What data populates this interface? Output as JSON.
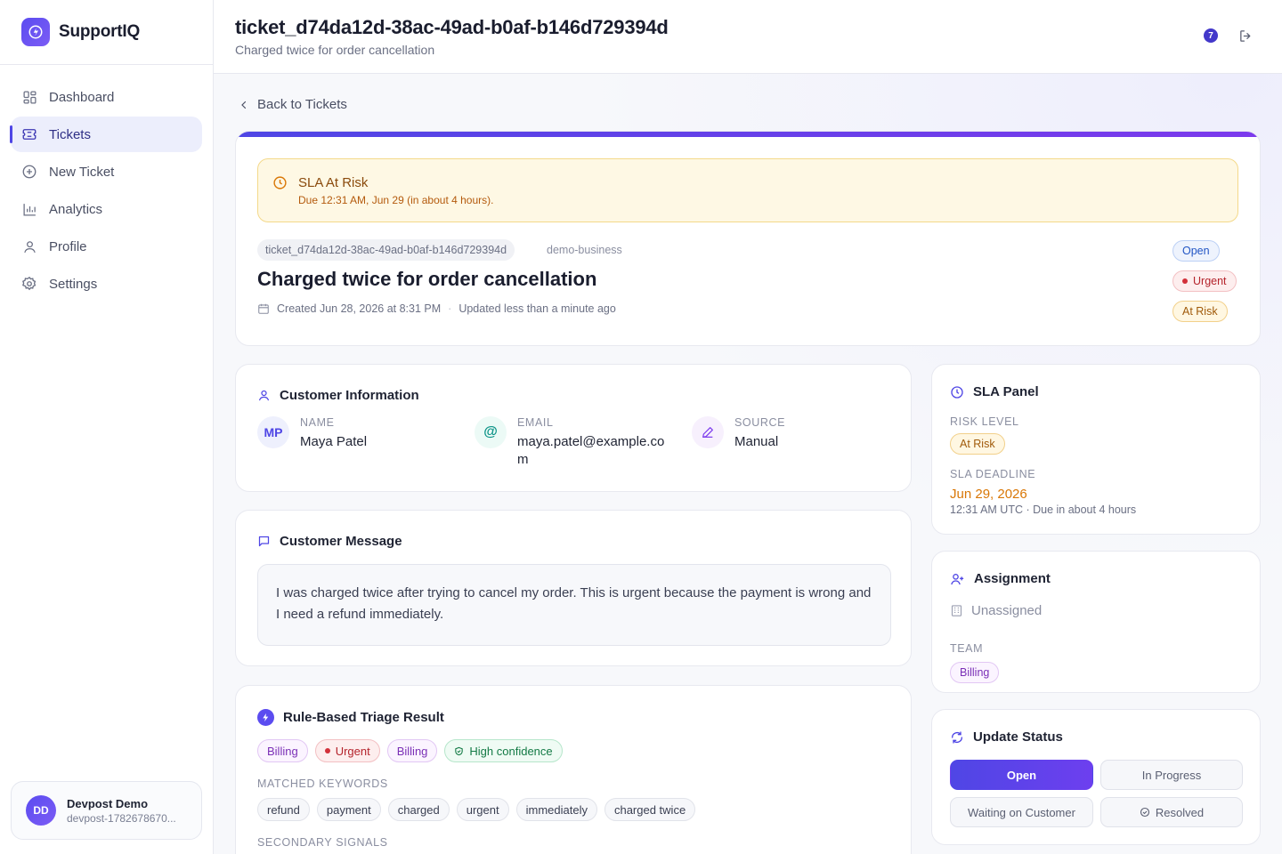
{
  "app": {
    "name": "SupportIQ"
  },
  "nav": [
    {
      "label": "Dashboard",
      "icon": "dashboard-icon"
    },
    {
      "label": "Tickets",
      "icon": "ticket-icon",
      "active": true
    },
    {
      "label": "New Ticket",
      "icon": "plus-circle-icon"
    },
    {
      "label": "Analytics",
      "icon": "bar-chart-icon"
    },
    {
      "label": "Profile",
      "icon": "user-icon"
    },
    {
      "label": "Settings",
      "icon": "gear-icon"
    }
  ],
  "user": {
    "initials": "DD",
    "name": "Devpost Demo",
    "id": "devpost-1782678670..."
  },
  "header": {
    "title": "ticket_d74da12d-38ac-49ad-b0af-b146d729394d",
    "subtitle": "Charged twice for order cancellation",
    "notification_count": "7"
  },
  "back_label": "Back to Tickets",
  "hero": {
    "sla_alert_title": "SLA At Risk",
    "sla_alert_detail": "Due 12:31 AM, Jun 29 (in about 4 hours).",
    "ticket_id": "ticket_d74da12d-38ac-49ad-b0af-b146d729394d",
    "org": "demo-business",
    "title": "Charged twice for order cancellation",
    "created": "Created Jun 28, 2026 at 8:31 PM",
    "sep": "·",
    "updated": "Updated less than a minute ago",
    "badges": {
      "status": "Open",
      "priority": "Urgent",
      "sla": "At Risk"
    }
  },
  "customer": {
    "section_title": "Customer Information",
    "initials": "MP",
    "name_label": "Name",
    "name": "Maya Patel",
    "email_label": "Email",
    "email": "maya.patel@example.com",
    "source_label": "Source",
    "source": "Manual"
  },
  "message": {
    "section_title": "Customer Message",
    "body": "I was charged twice after trying to cancel my order. This is urgent because the payment is wrong and I need a refund immediately."
  },
  "triage": {
    "section_title": "Rule-Based Triage Result",
    "chips": [
      "Billing",
      "Urgent",
      "Billing",
      "High confidence"
    ],
    "keywords_label": "Matched Keywords",
    "keywords": [
      "refund",
      "payment",
      "charged",
      "urgent",
      "immediately",
      "charged twice"
    ],
    "secondary_label": "Secondary Signals"
  },
  "sla_panel": {
    "section_title": "SLA Panel",
    "risk_label": "Risk Level",
    "risk": "At Risk",
    "deadline_label": "SLA Deadline",
    "deadline_date": "Jun 29, 2026",
    "deadline_detail": "12:31 AM UTC · Due in about 4 hours"
  },
  "assignment": {
    "section_title": "Assignment",
    "assignee": "Unassigned",
    "team_label": "Team",
    "team": "Billing"
  },
  "update_status": {
    "section_title": "Update Status",
    "options": [
      "Open",
      "In Progress",
      "Waiting on Customer",
      "Resolved"
    ],
    "selected": "Open"
  },
  "colors": {
    "accent": "#4f46e5",
    "warning": "#d97706",
    "danger": "#d2303a",
    "success": "#137a45"
  }
}
